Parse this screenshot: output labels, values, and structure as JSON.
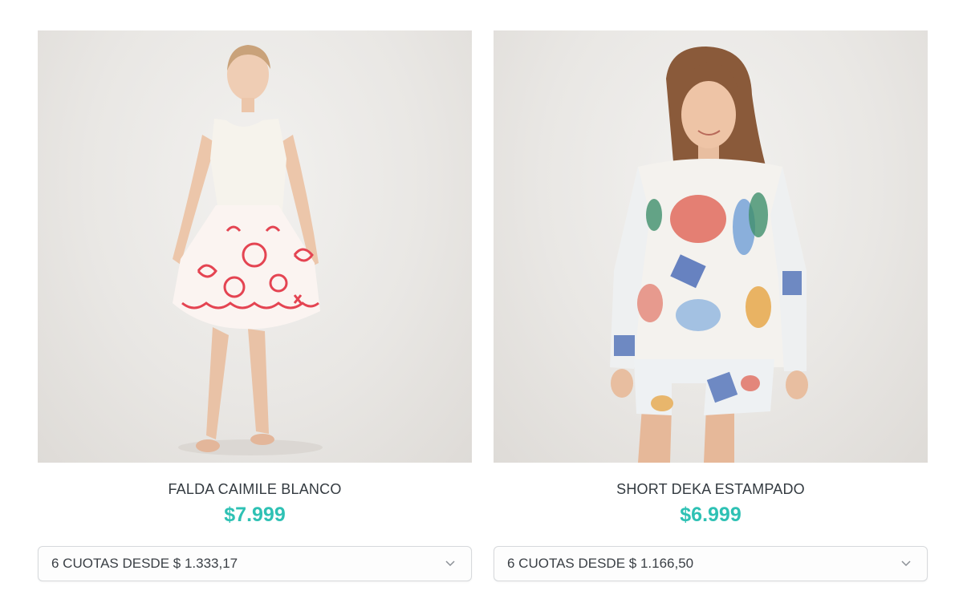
{
  "products": [
    {
      "image_alt": "Girl wearing white top and red-print skirt",
      "title": "FALDA CAIMILE BLANCO",
      "price": "$7.999",
      "installments": "6 CUOTAS DESDE $ 1.333,17"
    },
    {
      "image_alt": "Girl wearing colorful printed sweatshirt and shorts",
      "title": "SHORT DEKA ESTAMPADO",
      "price": "$6.999",
      "installments": "6 CUOTAS DESDE $ 1.166,50"
    }
  ],
  "colors": {
    "price": "#2ec1b4",
    "title": "#333a40",
    "border": "#d7d9dc"
  },
  "icons": {
    "dropdown": "chevron-down-icon"
  }
}
